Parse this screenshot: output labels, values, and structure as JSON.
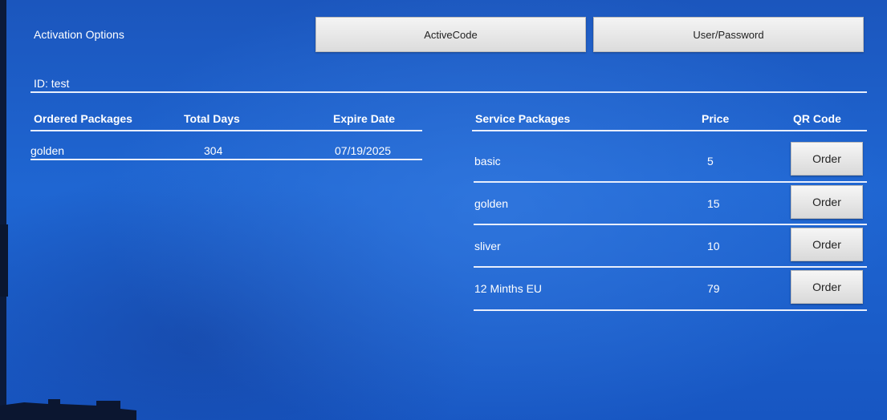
{
  "header": {
    "title": "Activation Options",
    "tabs": [
      "ActiveCode",
      "User/Password"
    ]
  },
  "account": {
    "id_label": "ID: test"
  },
  "ordered": {
    "headers": [
      "Ordered Packages",
      "Total Days",
      "Expire Date"
    ],
    "rows": [
      {
        "name": "golden",
        "days": "304",
        "expire": "07/19/2025"
      }
    ]
  },
  "service": {
    "headers": [
      "Service Packages",
      "Price",
      "QR Code"
    ],
    "order_label": "Order",
    "rows": [
      {
        "name": "basic",
        "price": "5"
      },
      {
        "name": "golden",
        "price": "15"
      },
      {
        "name": "sliver",
        "price": "10"
      },
      {
        "name": "12 Minths EU",
        "price": "79"
      }
    ]
  }
}
